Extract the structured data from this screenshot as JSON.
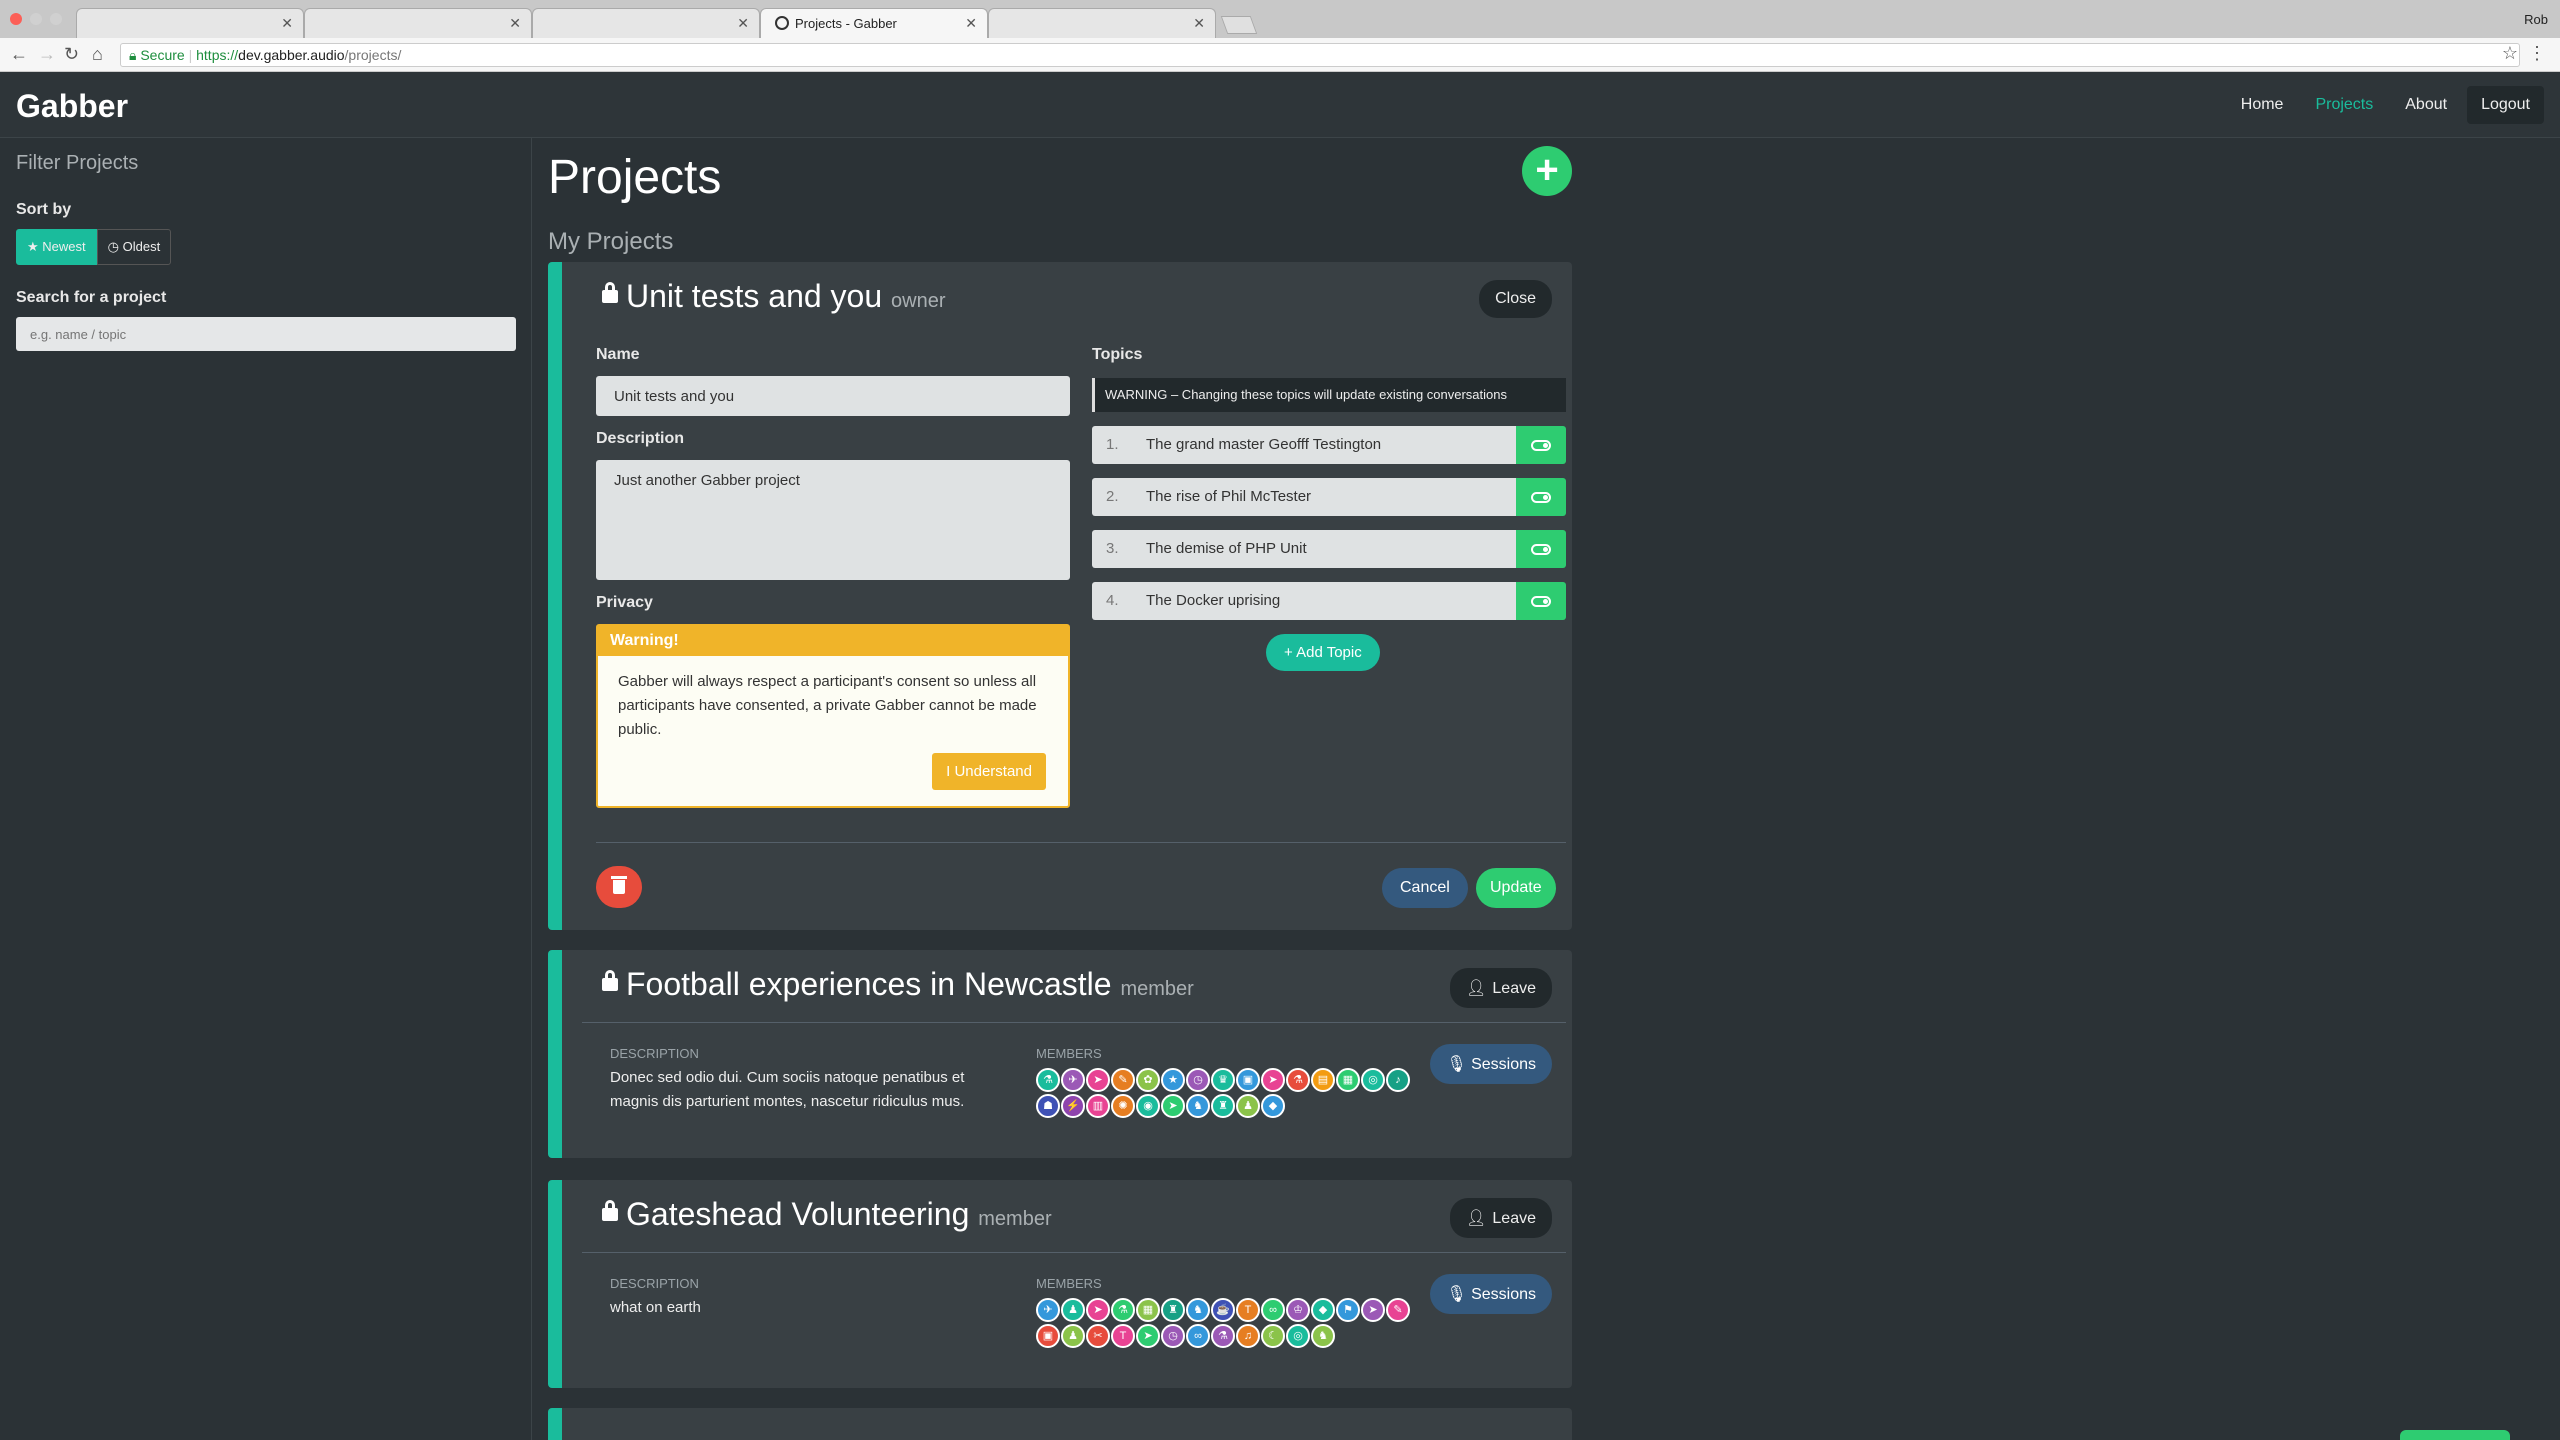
{
  "browser": {
    "active_tab_title": "Projects - Gabber",
    "url_secure": "Secure",
    "url_scheme": "https://",
    "url_host": "dev.gabber.audio",
    "url_path": "/projects/",
    "profile": "Rob"
  },
  "nav": {
    "brand": "Gabber",
    "links": [
      "Home",
      "Projects",
      "About"
    ],
    "active": "Projects",
    "logout": "Logout"
  },
  "sidebar": {
    "title": "Filter Projects",
    "sort_label": "Sort by",
    "sort_newest": "Newest",
    "sort_oldest": "Oldest",
    "search_label": "Search for a project",
    "search_placeholder": "e.g. name / topic"
  },
  "page": {
    "title": "Projects",
    "section": "My Projects"
  },
  "editing_project": {
    "title": "Unit tests and you",
    "role": "owner",
    "close_label": "Close",
    "name_label": "Name",
    "name_value": "Unit tests and you",
    "description_label": "Description",
    "description_value": "Just another Gabber project",
    "privacy_label": "Privacy",
    "warning_title": "Warning!",
    "warning_text": "Gabber will always respect a participant's consent so unless all participants have consented, a private Gabber cannot be made public.",
    "understand_label": "I Understand",
    "topics_label": "Topics",
    "topics_warning": "WARNING  –  Changing these topics will update existing conversations",
    "topics": [
      {
        "num": "1.",
        "text": "The grand master Geofff Testington"
      },
      {
        "num": "2.",
        "text": "The rise of Phil McTester"
      },
      {
        "num": "3.",
        "text": "The demise of PHP Unit"
      },
      {
        "num": "4.",
        "text": "The Docker uprising"
      }
    ],
    "add_topic_label": "Add Topic",
    "cancel_label": "Cancel",
    "update_label": "Update"
  },
  "projects": [
    {
      "title": "Football experiences in Newcastle",
      "role": "member",
      "leave_label": "Leave",
      "description_label": "DESCRIPTION",
      "description": "Donec sed odio dui. Cum sociis natoque penatibus et magnis dis parturient montes, nascetur ridiculus mus.",
      "members_label": "MEMBERS",
      "sessions_label": "Sessions"
    },
    {
      "title": "Gateshead Volunteering",
      "role": "member",
      "leave_label": "Leave",
      "description_label": "DESCRIPTION",
      "description": "what on earth",
      "members_label": "MEMBERS",
      "sessions_label": "Sessions"
    }
  ],
  "colors": {
    "accent": "#1abc9c",
    "success": "#2ecc71",
    "danger": "#e74c3c",
    "warning": "#f0b429",
    "primary_dark": "#34597e"
  }
}
